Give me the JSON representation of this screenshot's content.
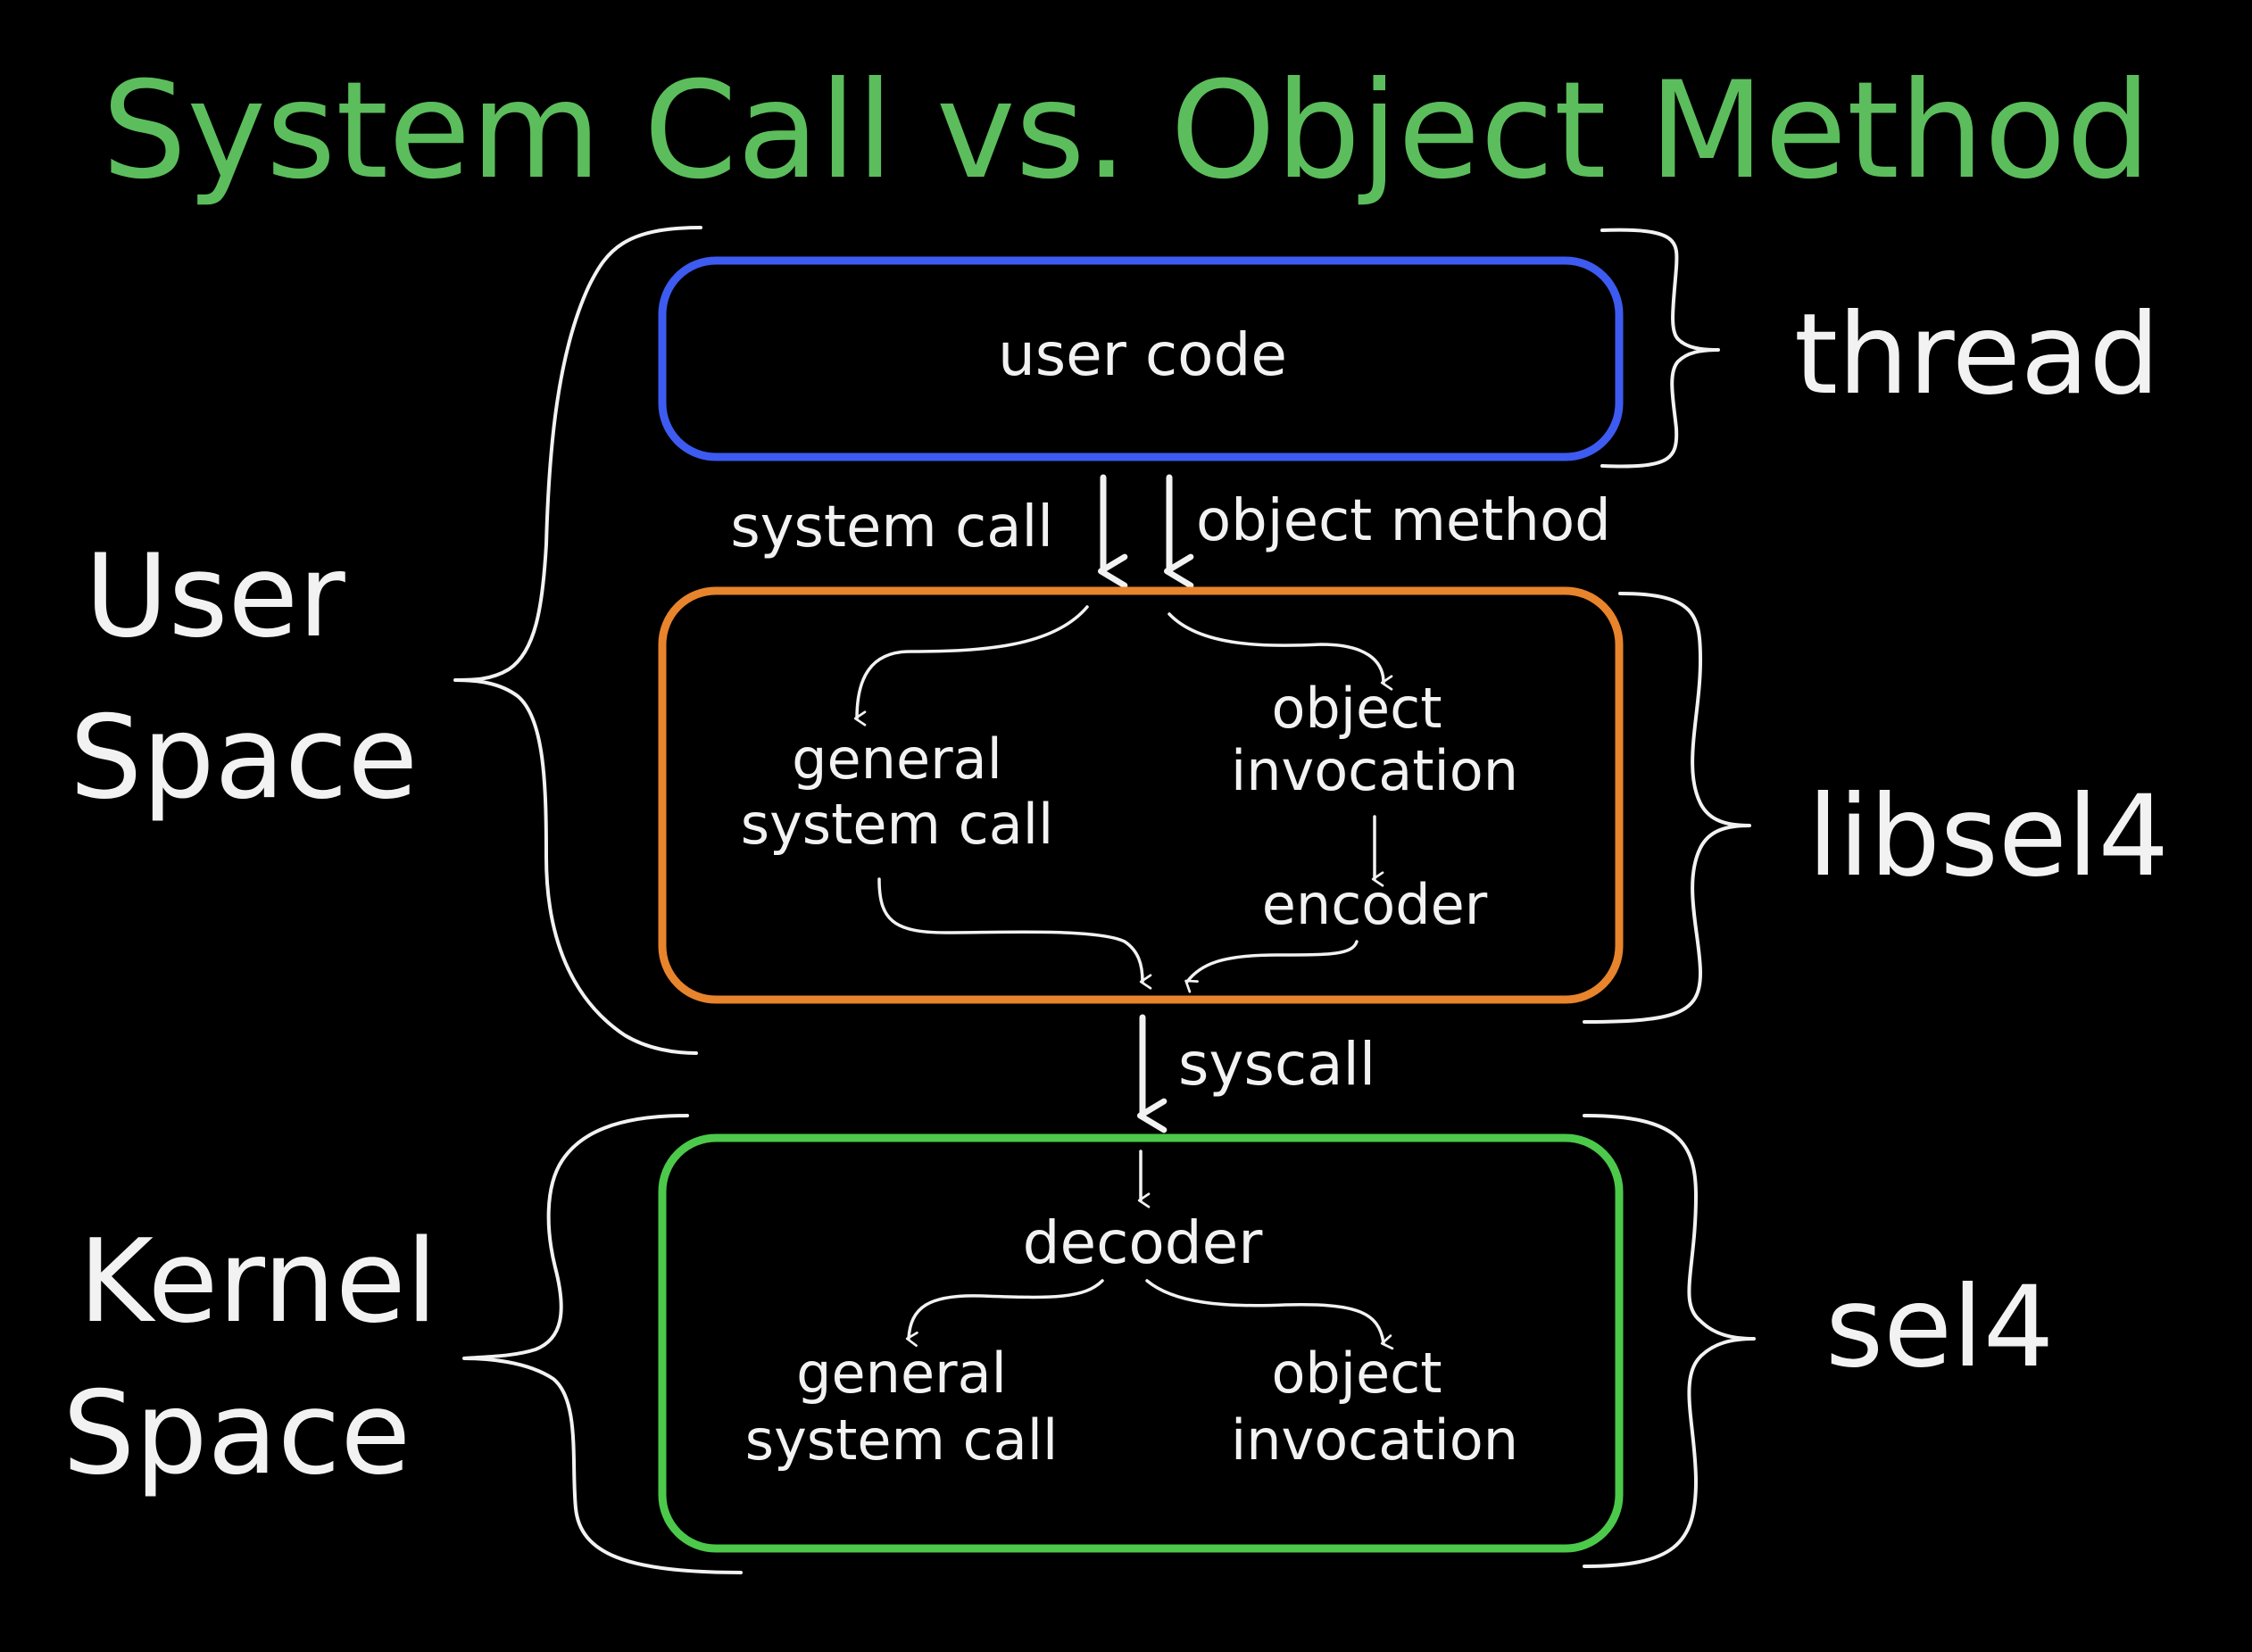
{
  "title": "System Call vs. Object Method",
  "colors": {
    "title": "#5cbd5c",
    "background": "#000000",
    "ink": "#f2f2f2",
    "thread_box": "#3d5bf0",
    "libsel4_box": "#e8842c",
    "sel4_box": "#4cc94a"
  },
  "regions": {
    "user_space": "User Space",
    "kernel_space": "Kernel Space",
    "thread": "thread",
    "libsel4": "libsel4",
    "sel4": "sel4"
  },
  "user_space_lines": [
    "User",
    "Space"
  ],
  "kernel_space_lines": [
    "Kernel",
    "Space"
  ],
  "thread_box": {
    "label": "user code"
  },
  "arrows_from_user": {
    "left_label": "system call",
    "right_label": "object method"
  },
  "libsel4_box": {
    "left_node_lines": [
      "general",
      "system call"
    ],
    "right_node_lines": [
      "object",
      "invocation"
    ],
    "encoder": "encoder"
  },
  "syscall_label": "syscall",
  "sel4_box": {
    "decoder": "decoder",
    "left_node_lines": [
      "general",
      "system call"
    ],
    "right_node_lines": [
      "object",
      "invocation"
    ]
  }
}
